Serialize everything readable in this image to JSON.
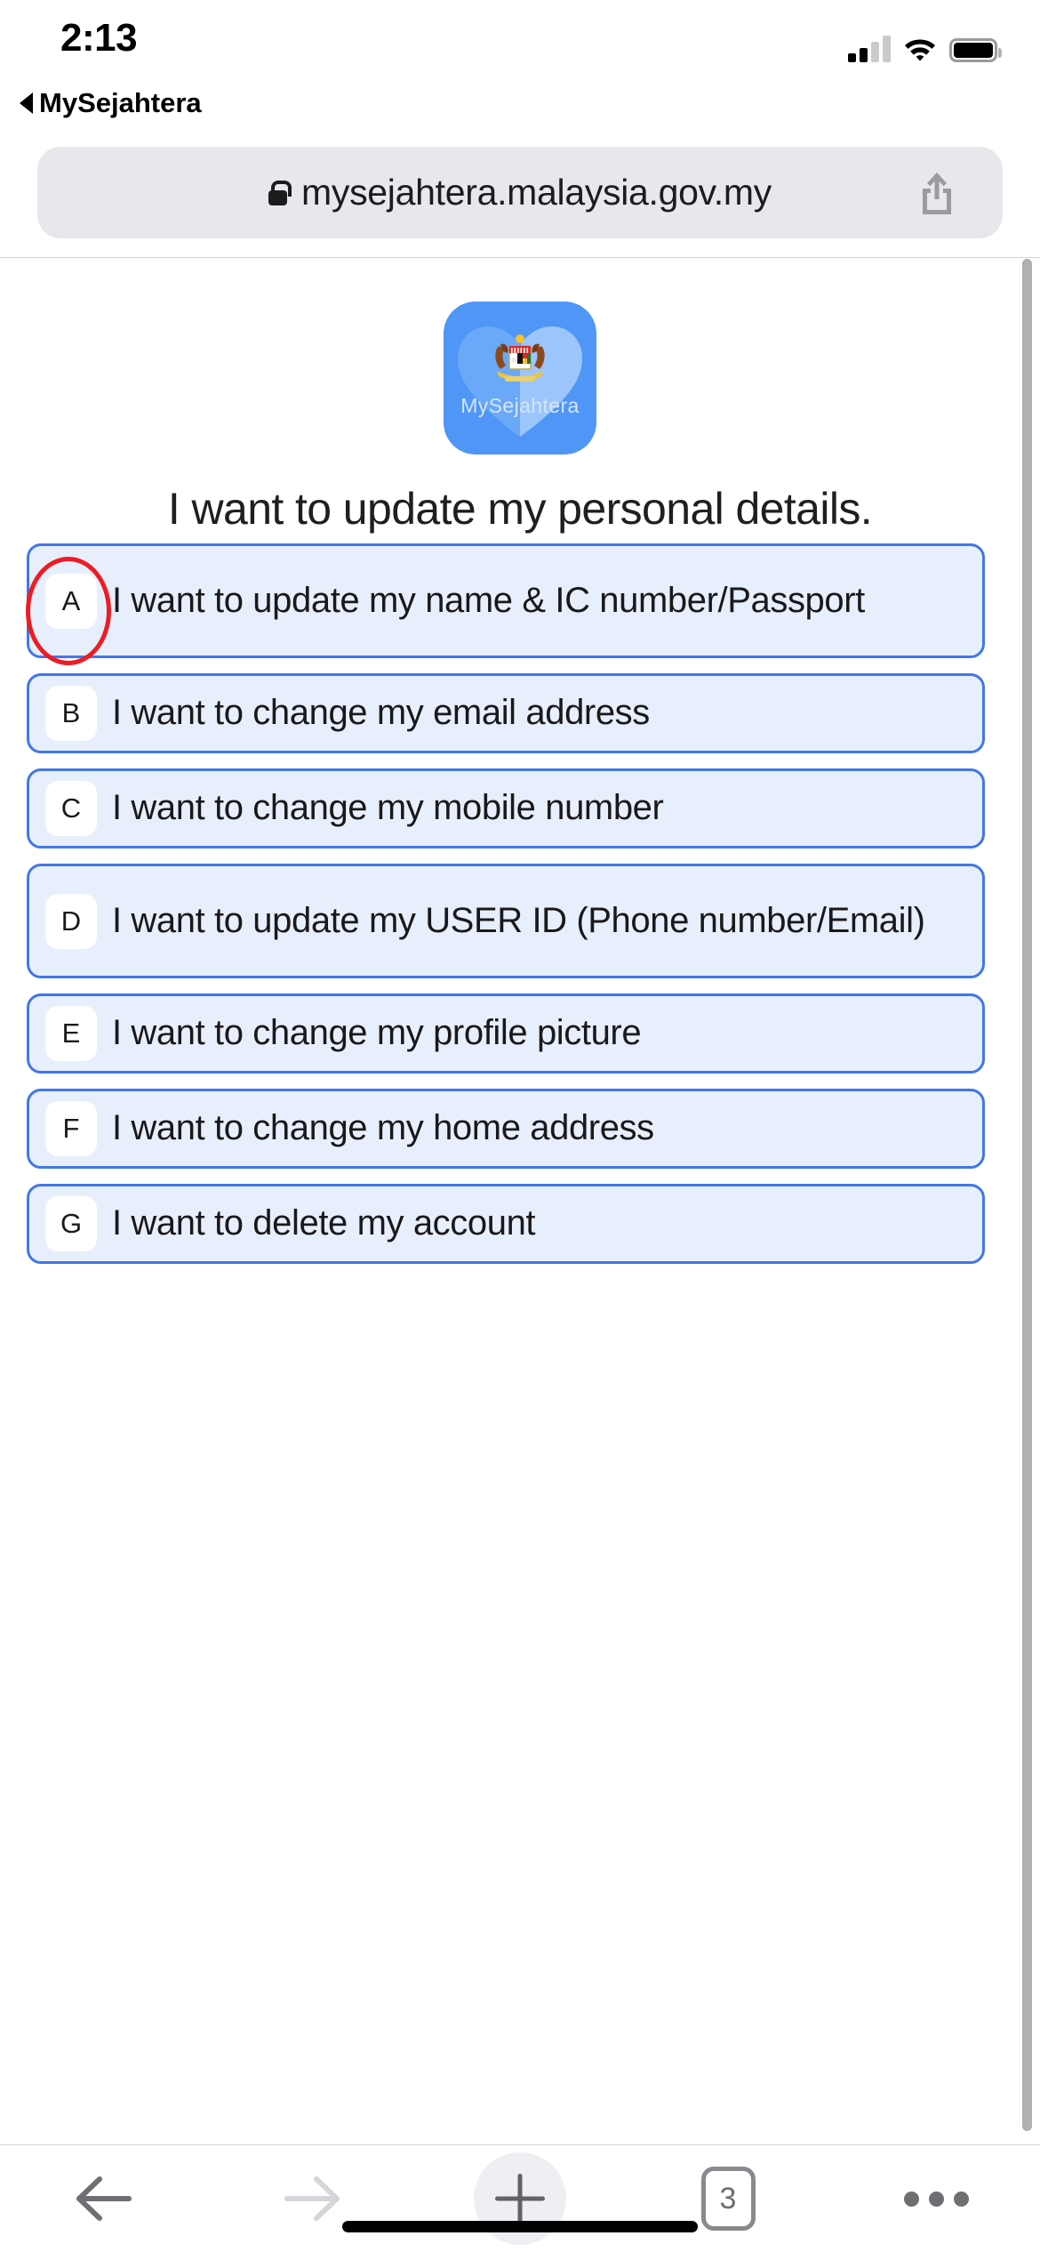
{
  "status_bar": {
    "time": "2:13",
    "icons": [
      "cellular-signal-icon",
      "wifi-icon",
      "battery-icon"
    ]
  },
  "back_to_app": {
    "label": "MySejahtera",
    "icon": "back-triangle-icon"
  },
  "browser": {
    "address_bar": {
      "url": "mysejahtera.malaysia.gov.my",
      "lock_icon": "lock-icon",
      "share_icon": "share-icon"
    },
    "toolbar": {
      "back_label": "back-arrow-icon",
      "forward_label": "forward-arrow-icon",
      "new_tab_label": "plus-icon",
      "tab_count": "3",
      "more_label": "more-dots-icon"
    }
  },
  "page": {
    "logo": {
      "brand_text": "MySejahtera",
      "background_color": "#4f96f6",
      "heart_color": "#82b6f9"
    },
    "heading": "I want to update my personal details.",
    "options": [
      {
        "letter": "A",
        "label": "I want to update my name & IC number/Passport",
        "lines": 2,
        "annotated": true
      },
      {
        "letter": "B",
        "label": "I want to change my email address",
        "lines": 1,
        "annotated": false
      },
      {
        "letter": "C",
        "label": "I want to change my mobile number",
        "lines": 1,
        "annotated": false
      },
      {
        "letter": "D",
        "label": "I want to update my USER ID (Phone number/Email)",
        "lines": 2,
        "annotated": false
      },
      {
        "letter": "E",
        "label": "I want to change my profile picture",
        "lines": 1,
        "annotated": false
      },
      {
        "letter": "F",
        "label": "I want to change my home address",
        "lines": 1,
        "annotated": false
      },
      {
        "letter": "G",
        "label": "I want to delete my account",
        "lines": 1,
        "annotated": false
      }
    ],
    "colors": {
      "option_fill": "#e8effc",
      "option_border": "#4277e8",
      "annotation": "#ed1c24"
    }
  }
}
